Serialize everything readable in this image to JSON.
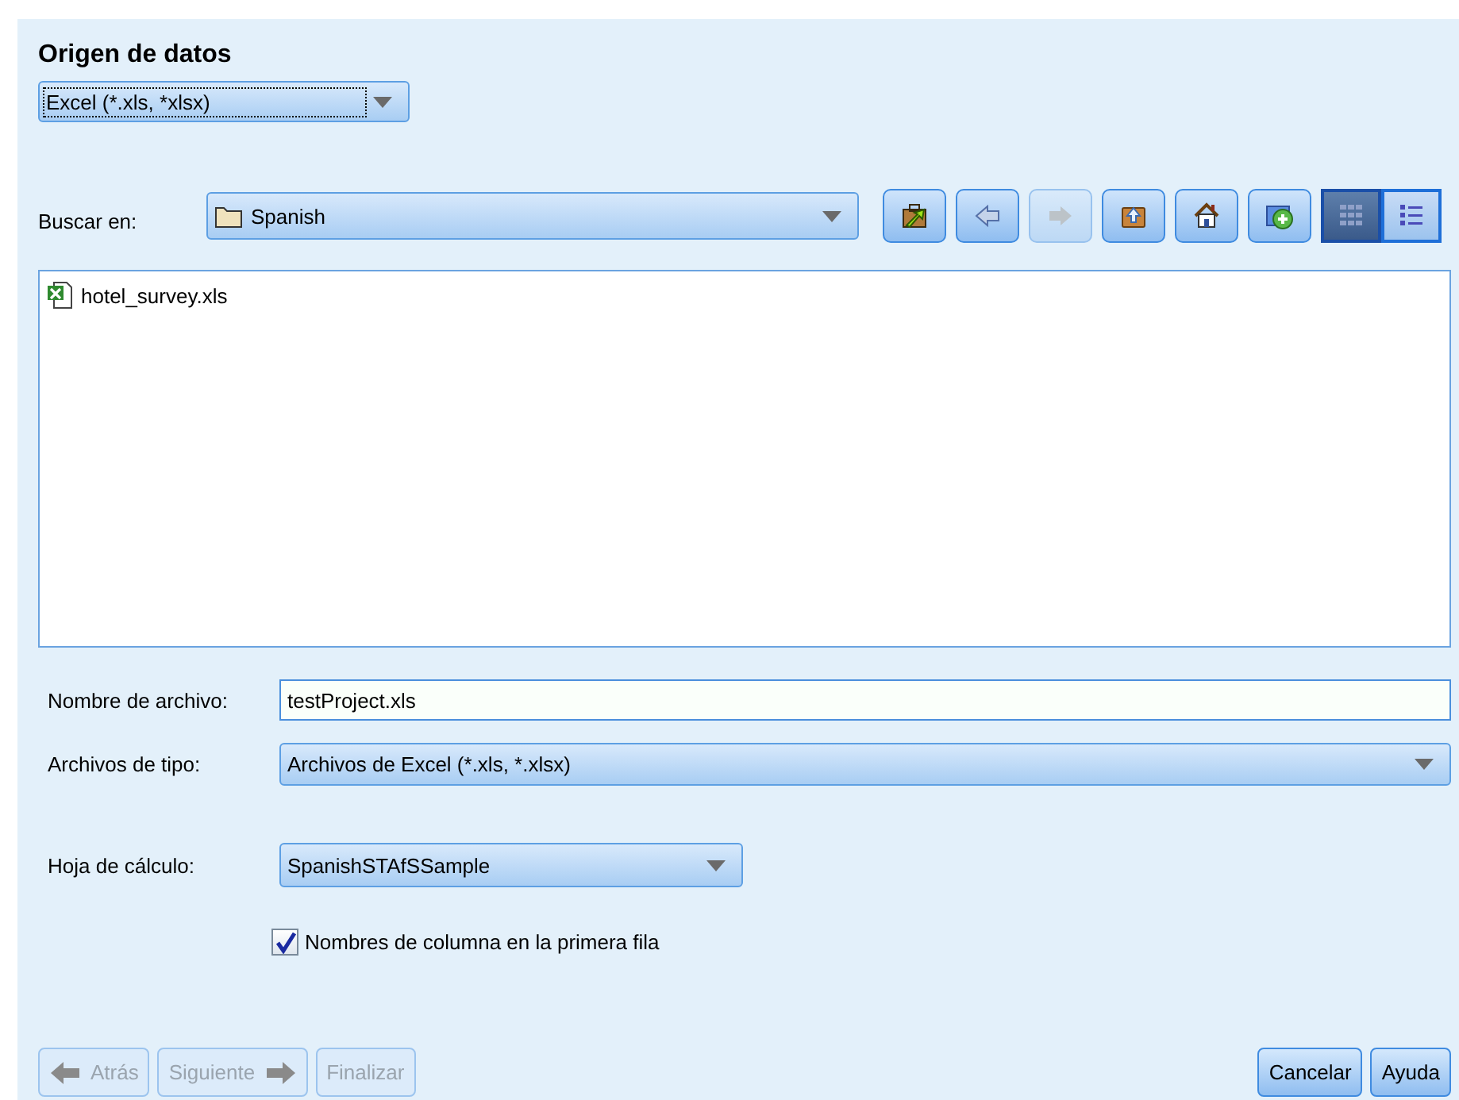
{
  "title": "Origen de datos",
  "source_dropdown": {
    "value": "Excel (*.xls, *xlsx)",
    "focused": true
  },
  "look_in": {
    "label": "Buscar en:",
    "value": "Spanish"
  },
  "toolbar": [
    {
      "kind": "recent",
      "disabled": false
    },
    {
      "kind": "back",
      "disabled": false
    },
    {
      "kind": "forward",
      "disabled": true
    },
    {
      "kind": "up",
      "disabled": false
    },
    {
      "kind": "home",
      "disabled": false
    },
    {
      "kind": "new-folder",
      "disabled": false
    }
  ],
  "view_buttons": [
    {
      "kind": "grid",
      "selected": true
    },
    {
      "kind": "list",
      "selected": false
    }
  ],
  "files": [
    {
      "name": "hotel_survey.xls"
    }
  ],
  "file_name": {
    "label": "Nombre de archivo:",
    "value": "testProject.xls"
  },
  "file_type": {
    "label": "Archivos de tipo:",
    "value": "Archivos de Excel (*.xls, *.xlsx)"
  },
  "sheet": {
    "label": "Hoja de cálculo:",
    "value": "SpanishSTAfSSample"
  },
  "header_checkbox": {
    "label": "Nombres de columna en la primera fila",
    "checked": true
  },
  "wizard_buttons": [
    {
      "label": "Atrás",
      "kind": "back",
      "disabled": true
    },
    {
      "label": "Siguiente",
      "kind": "next",
      "disabled": true
    },
    {
      "label": "Finalizar",
      "kind": "plain",
      "disabled": true
    }
  ],
  "dialog_buttons": [
    {
      "label": "Cancelar",
      "disabled": false
    },
    {
      "label": "Ayuda",
      "disabled": false
    }
  ]
}
